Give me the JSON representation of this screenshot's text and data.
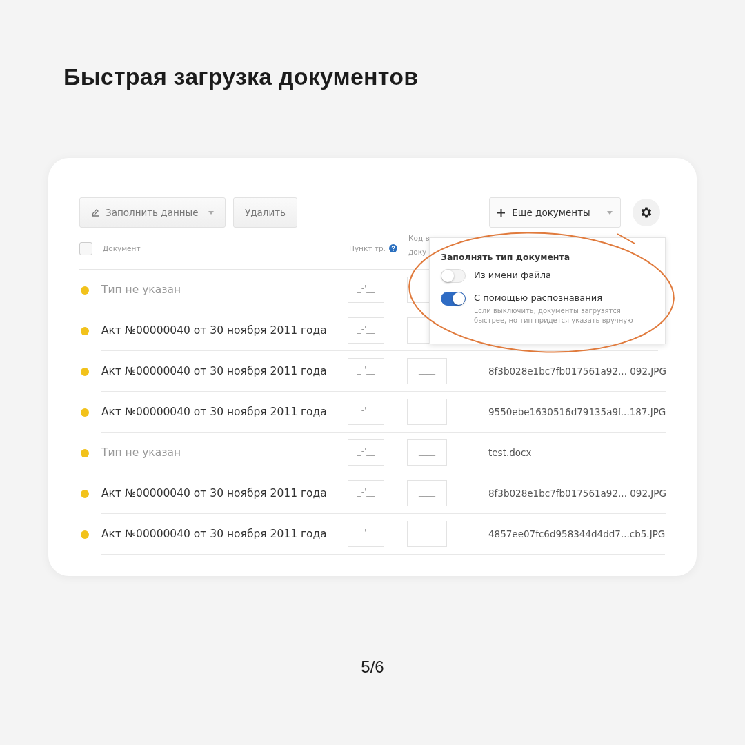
{
  "heading": "Быстрая загрузка документов",
  "toolbar": {
    "left_buttons": [
      {
        "label": "Заполнить данные",
        "kind": "dropdown"
      },
      {
        "label": "Удалить",
        "kind": "plain"
      }
    ],
    "add_button": {
      "label": "Еще документы"
    }
  },
  "table": {
    "select_all_checked": false,
    "columns": [
      "Документ",
      "Пункт тр.",
      "Код в доку"
    ],
    "rows": [
      {
        "document": "Тип не указан",
        "type_set": false,
        "field_1": {
          "placeholder": "_-'__"
        },
        "field_2": {}
      },
      {
        "document": "Акт №00000040 от 30 ноября 2011 года",
        "type_set": true,
        "field_1": {
          "placeholder": "_-'__"
        },
        "field_2": {}
      },
      {
        "document": "Акт №00000040 от 30 ноября 2011 года",
        "type_set": true,
        "field_1": {
          "placeholder": "_-'__"
        },
        "field_2": {
          "placeholder": "____"
        },
        "file": "8f3b028e1bc7fb017561a92... 092.JPG"
      },
      {
        "document": "Акт №00000040 от 30 ноября 2011 года",
        "type_set": true,
        "field_1": {
          "placeholder": "_-'__"
        },
        "field_2": {
          "placeholder": "____"
        },
        "file": "9550ebe1630516d79135a9f...187.JPG"
      },
      {
        "document": "Тип не указан",
        "type_set": false,
        "field_1": {
          "placeholder": "_-'__"
        },
        "field_2": {
          "placeholder": "____"
        },
        "file": "test.docx"
      },
      {
        "document": "Акт №00000040 от 30 ноября 2011 года",
        "type_set": true,
        "field_1": {
          "placeholder": "_-'__"
        },
        "field_2": {
          "placeholder": "____"
        },
        "file": "8f3b028e1bc7fb017561a92... 092.JPG"
      },
      {
        "document": "Акт №00000040 от 30 ноября 2011 года",
        "type_set": true,
        "field_1": {
          "placeholder": "_-'__"
        },
        "field_2": {
          "placeholder": "____"
        },
        "file": "4857ee07fc6d958344d4dd7...cb5.JPG"
      }
    ]
  },
  "settings_popover": {
    "title": "Заполнять тип документа",
    "options": [
      {
        "label": "Из имени файла",
        "on": false
      },
      {
        "label": "С помощью распознавания",
        "on": true,
        "hint": "Если выключить, документы загрузятся быстрее, но тип придется указать вручную"
      }
    ]
  },
  "page_counter": "5/6"
}
